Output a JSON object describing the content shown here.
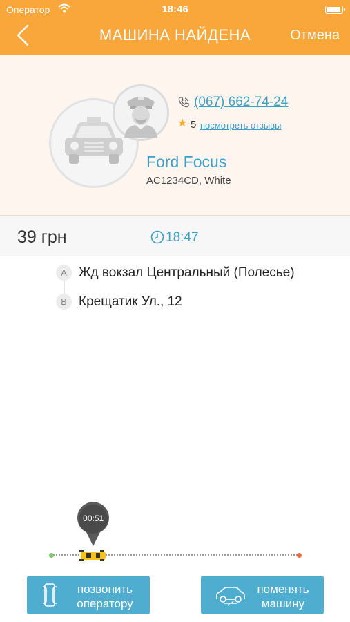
{
  "status_bar": {
    "carrier": "Оператор",
    "time": "18:46",
    "battery_level": 0.95
  },
  "nav": {
    "title": "МАШИНА НАЙДЕНА",
    "cancel_label": "Отмена",
    "back_icon": "chevron-left-icon"
  },
  "driver": {
    "phone": "(067) 662-74-24",
    "rating": "5",
    "reviews_label": "посмотреть отзывы",
    "car_model": "Ford Focus",
    "car_details": "AC1234CD, White"
  },
  "trip": {
    "price": "39 грн",
    "arrival_time": "18:47"
  },
  "route": {
    "points": [
      {
        "letter": "A",
        "address": "Жд вокзал Центральный (Полесье)"
      },
      {
        "letter": "B",
        "address": "Крещатик Ул., 12"
      }
    ]
  },
  "progress": {
    "timer": "00:51",
    "fraction": 0.17
  },
  "buttons": {
    "call_operator": {
      "line1": "позвонить",
      "line2": "оператору"
    },
    "change_car": {
      "line1": "поменять",
      "line2": "машину"
    }
  },
  "colors": {
    "header": "#f9a63a",
    "accent": "#3c9fc7",
    "button": "#4fadd0",
    "star": "#f6a623"
  }
}
